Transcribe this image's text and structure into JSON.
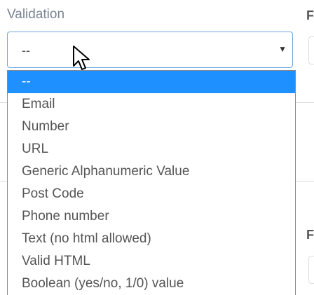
{
  "field": {
    "label": "Validation",
    "selected_value": "--"
  },
  "dropdown": {
    "options": [
      {
        "label": "--",
        "selected": true
      },
      {
        "label": "Email",
        "selected": false
      },
      {
        "label": "Number",
        "selected": false
      },
      {
        "label": "URL",
        "selected": false
      },
      {
        "label": "Generic Alphanumeric Value",
        "selected": false
      },
      {
        "label": "Post Code",
        "selected": false
      },
      {
        "label": "Phone number",
        "selected": false
      },
      {
        "label": "Text (no html allowed)",
        "selected": false
      },
      {
        "label": "Valid HTML",
        "selected": false
      },
      {
        "label": "Boolean (yes/no, 1/0) value",
        "selected": false
      }
    ]
  },
  "adjacent_field": {
    "label_fragment_top": "F",
    "label_fragment_lower": "F"
  },
  "colors": {
    "accent": "#1e90ff",
    "focus_border": "#6fa8dc",
    "label": "#7b8594"
  },
  "icons": {
    "dropdown_arrow": "triangle-down",
    "pointer": "mouse-cursor"
  }
}
